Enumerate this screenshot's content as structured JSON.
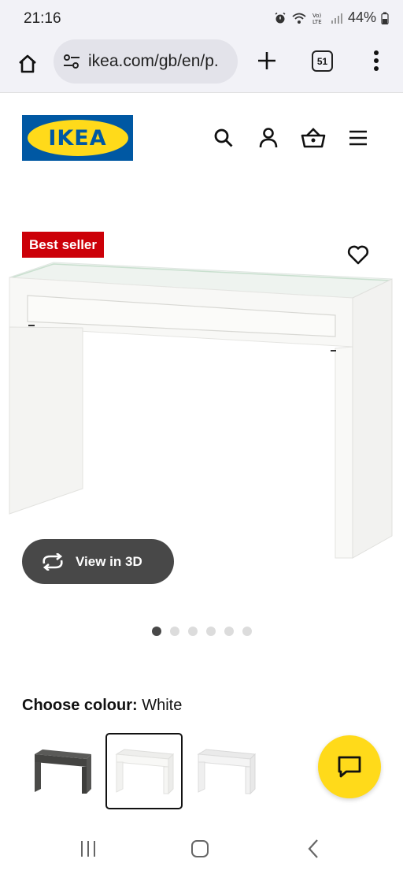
{
  "status_bar": {
    "time": "21:16",
    "battery": "44%"
  },
  "browser": {
    "url": "ikea.com/gb/en/p.",
    "tab_count": "51"
  },
  "site": {
    "logo_text": "IKEA",
    "brand_colors": {
      "blue": "#0058a3",
      "yellow": "#ffda1a",
      "badge_red": "#cc0008"
    }
  },
  "header_icons": [
    "search-icon",
    "account-icon",
    "basket-icon",
    "menu-icon"
  ],
  "product": {
    "badge": "Best seller",
    "view_3d_label": "View in 3D",
    "image_count": 6,
    "active_image": 1
  },
  "colour": {
    "label": "Choose colour:",
    "selected": "White",
    "options": [
      {
        "name": "black-brown",
        "color": "#4a4a48"
      },
      {
        "name": "white",
        "color": "#f7f7f5"
      },
      {
        "name": "white-light",
        "color": "#f0f0f0"
      }
    ]
  },
  "chat": {
    "icon": "chat-icon"
  },
  "android_nav": [
    "recents-icon",
    "home-icon",
    "back-icon"
  ]
}
